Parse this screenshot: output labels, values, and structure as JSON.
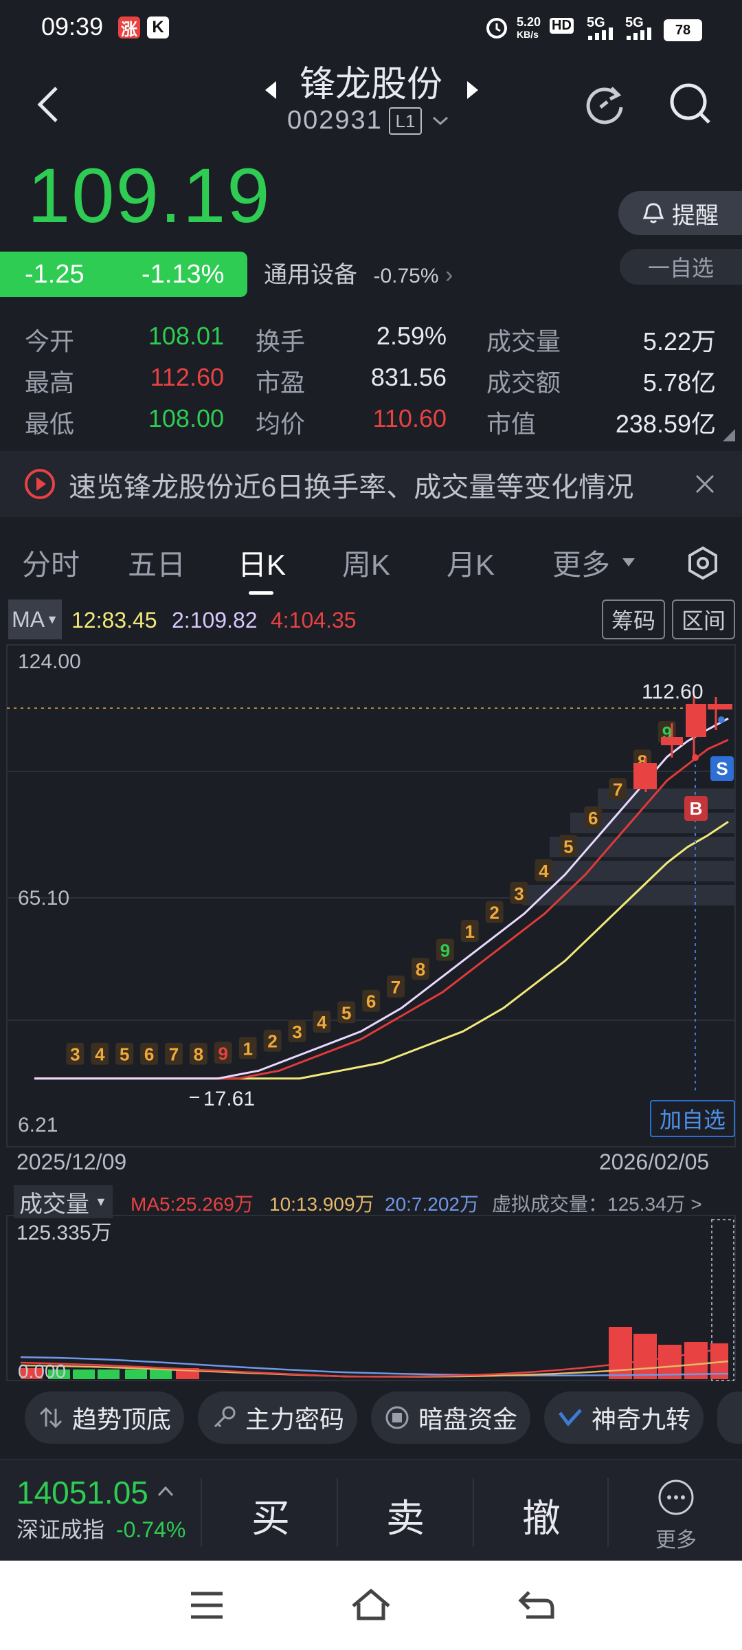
{
  "status_bar": {
    "time": "09:39",
    "net_speed": "5.20",
    "net_unit": "KB/s",
    "hd": "HD",
    "sig1": "5G",
    "sig2": "5G",
    "battery": "78"
  },
  "header": {
    "name": "锋龙股份",
    "code": "002931",
    "level": "L1"
  },
  "price": {
    "current": "109.19",
    "change": "-1.25",
    "change_pct": "-1.13%",
    "remind_label": "提醒",
    "watch_label": "一自选",
    "sector": "通用设备",
    "sector_pct": "-0.75%"
  },
  "quote": [
    {
      "label": "今开",
      "value": "108.01",
      "color": "green"
    },
    {
      "label": "换手",
      "value": "2.59%",
      "color": "white"
    },
    {
      "label": "成交量",
      "value": "5.22万",
      "color": "white"
    },
    {
      "label": "最高",
      "value": "112.60",
      "color": "red"
    },
    {
      "label": "市盈",
      "value": "831.56",
      "color": "white"
    },
    {
      "label": "成交额",
      "value": "5.78亿",
      "color": "white"
    },
    {
      "label": "最低",
      "value": "108.00",
      "color": "green"
    },
    {
      "label": "均价",
      "value": "110.60",
      "color": "red"
    },
    {
      "label": "市值",
      "value": "238.59亿",
      "color": "white"
    }
  ],
  "banner": {
    "text": "速览锋龙股份近6日换手率、成交量等变化情况"
  },
  "tabs": [
    "分时",
    "五日",
    "日K",
    "周K",
    "月K",
    "更多"
  ],
  "ma": {
    "select": "MA",
    "ma1": "12:83.45",
    "ma2": "2:109.82",
    "ma3": "4:104.35",
    "chip_label": "筹码",
    "range_label": "区间"
  },
  "chart_data": {
    "type": "candlestick",
    "y_axis": {
      "top": "124.00",
      "mid": "65.10",
      "bottom": "6.21"
    },
    "x_axis": {
      "start": "2025/12/09",
      "end": "2026/02/05"
    },
    "high_label": "112.60",
    "low_label": "17.61",
    "add_watch_label": "加自选",
    "signals": [
      "B",
      "S"
    ],
    "colors": {
      "up": "#e84242",
      "down": "#2ecc52",
      "ma_white": "#e9d9ff",
      "ma_red": "#e03a3a",
      "ma_yellow": "#f3e97a"
    },
    "series_ma_white": [
      18,
      18,
      18,
      18,
      18,
      18,
      18,
      18,
      18,
      18,
      19,
      20,
      22,
      24,
      26,
      28,
      30,
      33,
      36,
      40,
      44,
      48,
      52,
      56,
      60,
      65,
      70,
      76,
      82,
      88,
      94,
      100,
      104,
      107,
      109.8
    ],
    "series_ma_red": [
      18,
      18,
      18,
      18,
      18,
      18,
      18,
      18,
      18,
      18,
      18,
      19,
      20,
      22,
      24,
      26,
      28,
      31,
      34,
      37,
      40,
      44,
      48,
      52,
      56,
      60,
      65,
      70,
      76,
      82,
      88,
      94,
      98,
      102,
      104.35
    ],
    "series_ma_yellow": [
      18,
      18,
      18,
      18,
      18,
      18,
      18,
      18,
      18,
      18,
      18,
      18,
      18,
      18,
      19,
      20,
      21,
      22,
      24,
      26,
      28,
      30,
      33,
      36,
      40,
      44,
      48,
      53,
      58,
      63,
      68,
      73,
      77,
      80,
      83.45
    ],
    "nine_turn_labels": [
      "3",
      "4",
      "5",
      "6",
      "7",
      "8",
      "9",
      "1",
      "2",
      "3",
      "4",
      "5",
      "6",
      "7",
      "8",
      "9",
      "1",
      "2",
      "3",
      "4",
      "5",
      "6",
      "7",
      "8",
      "9"
    ]
  },
  "volume": {
    "title": "成交量",
    "ma5": "MA5:25.269万",
    "ma10": "10:13.909万",
    "ma20": "20:7.202万",
    "virtual": "虚拟成交量：125.34万 >",
    "top": "125.335万",
    "bottom": "0.000"
  },
  "tools": [
    "趋势顶底",
    "主力密码",
    "暗盘资金",
    "神奇九转"
  ],
  "index": {
    "value": "14051.05",
    "name": "深证成指",
    "pct": "-0.74%"
  },
  "trade": {
    "buy": "买",
    "sell": "卖",
    "cancel": "撤",
    "more": "更多"
  }
}
